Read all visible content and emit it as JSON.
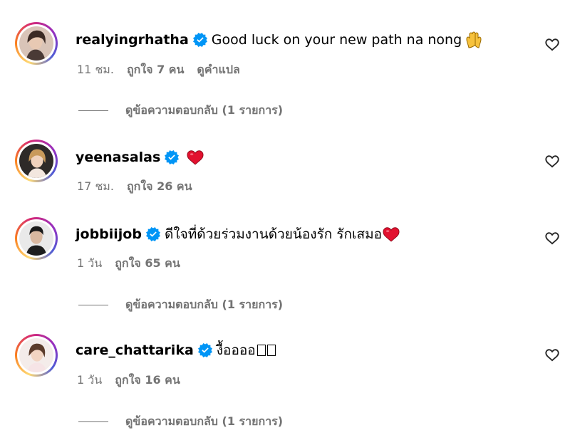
{
  "comments": [
    {
      "username": "realyingrhatha",
      "text": "Good luck on your new path na nong",
      "emoji": "🙌",
      "time": "11 ชม.",
      "likes": "ถูกใจ 7 คน",
      "translate": "ดูคำแปล",
      "replies": "ดูข้อความตอบกลับ (1 รายการ)"
    },
    {
      "username": "yeenasalas",
      "text": "",
      "emoji": "❤️",
      "time": "17 ชม.",
      "likes": "ถูกใจ 26 คน"
    },
    {
      "username": "jobbiijob",
      "text": "ดีใจที่ด้วยร่วมงานด้วยน้องรัก รักเสมอ",
      "emoji": "❤️",
      "time": "1 วัน",
      "likes": "ถูกใจ 65 คน",
      "replies": "ดูข้อความตอบกลับ (1 รายการ)"
    },
    {
      "username": "care_chattarika",
      "text": "งื้ออออ",
      "time": "1 วัน",
      "likes": "ถูกใจ 16 คน",
      "replies": "ดูข้อความตอบกลับ (1 รายการ)"
    }
  ],
  "colors": {
    "verified": "#0095f6",
    "secondary_text": "#737373",
    "heart_red": "#ed1c3a"
  },
  "icons": [
    "verified-badge-icon",
    "like-heart-icon",
    "raised-hands-emoji-icon",
    "red-heart-emoji-icon"
  ]
}
